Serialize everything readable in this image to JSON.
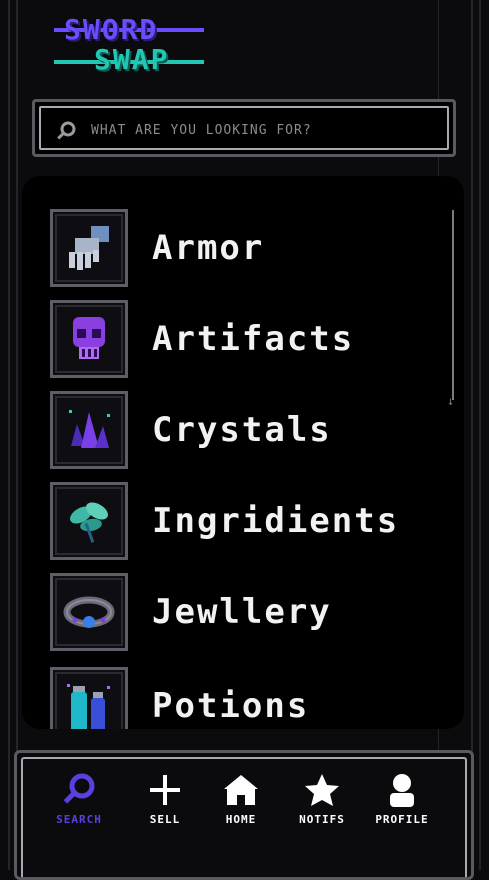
{
  "app": {
    "logo_line1": "SWORD",
    "logo_line2": "SWAP",
    "brand_purple": "#5b3fe0",
    "brand_teal": "#22c7b3"
  },
  "search": {
    "placeholder": "WHAT ARE YOU LOOKING FOR?",
    "icon": "search-icon"
  },
  "categories": [
    {
      "label": "Armor",
      "icon": "gauntlet-icon"
    },
    {
      "label": "Artifacts",
      "icon": "skull-icon"
    },
    {
      "label": "Crystals",
      "icon": "crystal-icon"
    },
    {
      "label": "Ingridients",
      "icon": "leaf-icon"
    },
    {
      "label": "Jewllery",
      "icon": "bracelet-icon"
    },
    {
      "label": "Potions",
      "icon": "potion-icon"
    }
  ],
  "nav": [
    {
      "label": "SEARCH",
      "icon": "search-icon",
      "active": true
    },
    {
      "label": "SELL",
      "icon": "plus-icon",
      "active": false
    },
    {
      "label": "HOME",
      "icon": "home-icon",
      "active": false
    },
    {
      "label": "NOTIFS",
      "icon": "star-icon",
      "active": false
    },
    {
      "label": "PROFILE",
      "icon": "person-icon",
      "active": false
    }
  ]
}
